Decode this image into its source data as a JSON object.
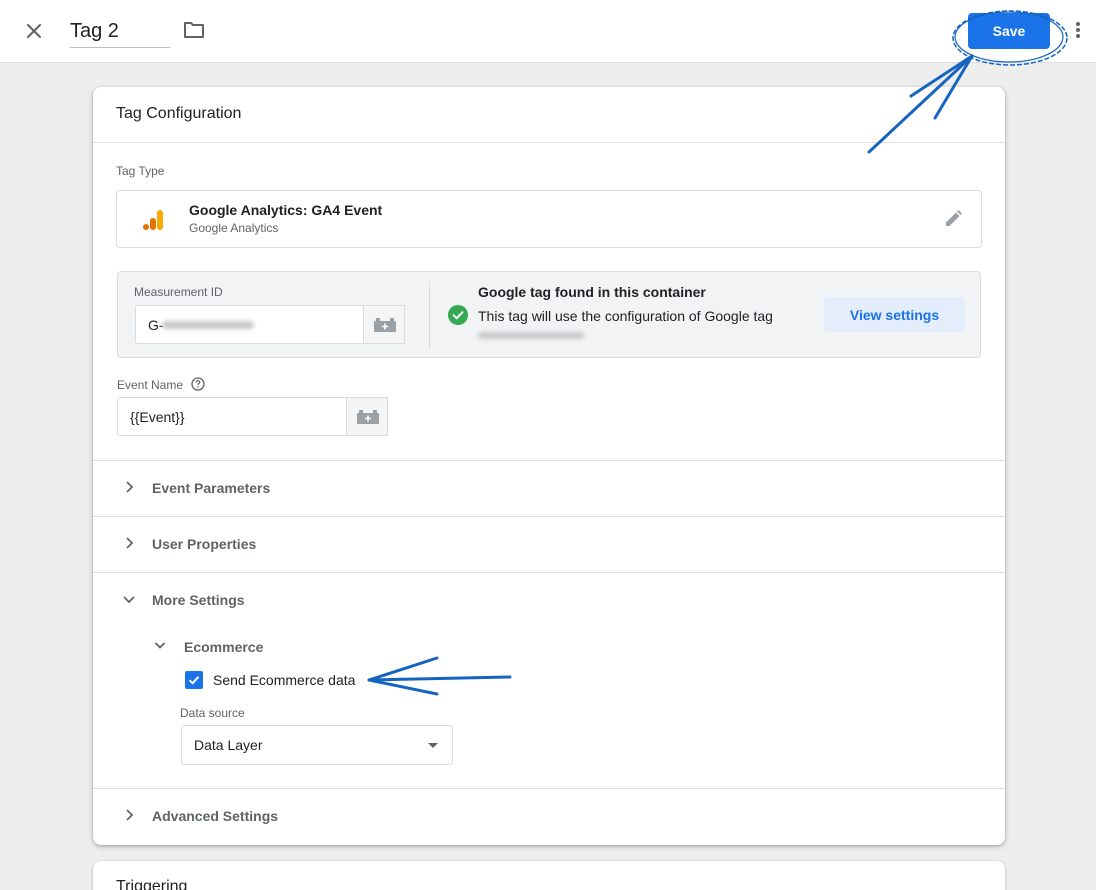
{
  "header": {
    "tag_name": "Tag 2",
    "save_label": "Save"
  },
  "config": {
    "title": "Tag Configuration",
    "tag_type_label": "Tag Type",
    "tag_type_name": "Google Analytics: GA4 Event",
    "tag_type_sub": "Google Analytics",
    "measurement_id_label": "Measurement ID",
    "measurement_id_value": "G-",
    "google_tag_found_title": "Google tag found in this container",
    "google_tag_found_desc": "This tag will use the configuration of Google tag",
    "view_settings_label": "View settings",
    "event_name_label": "Event Name",
    "event_name_value": "{{Event}}",
    "sections": {
      "event_parameters": "Event Parameters",
      "user_properties": "User Properties",
      "more_settings": "More Settings",
      "advanced_settings": "Advanced Settings"
    },
    "ecommerce": {
      "label": "Ecommerce",
      "send_data_label": "Send Ecommerce data",
      "send_data_checked": true,
      "data_source_label": "Data source",
      "data_source_value": "Data Layer"
    }
  },
  "triggering": {
    "title": "Triggering"
  },
  "colors": {
    "accent": "#1a73e8",
    "success": "#34a853",
    "annotation": "#1565c0"
  }
}
